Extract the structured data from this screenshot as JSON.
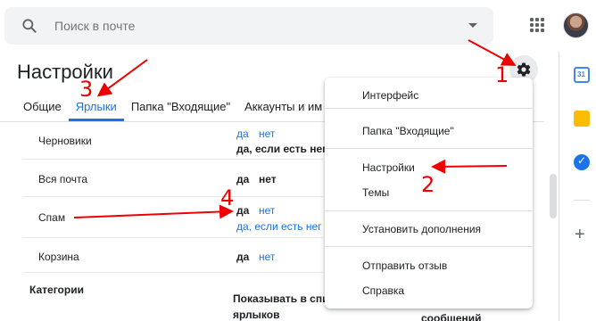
{
  "search": {
    "placeholder": "Поиск в почте",
    "value": ""
  },
  "header": {
    "title": "Настройки"
  },
  "tabs": [
    {
      "label": "Общие"
    },
    {
      "label": "Ярлыки"
    },
    {
      "label": "Папка \"Входящие\""
    },
    {
      "label": "Аккаунты и им"
    }
  ],
  "rows": [
    {
      "label": "Черновики",
      "links": [
        "да",
        "нет"
      ],
      "extra": "да, если есть нег"
    },
    {
      "label": "Вся почта",
      "bold": "да",
      "link": "нет"
    },
    {
      "label": "Спам",
      "bold": "да",
      "link": "нет",
      "extra": "да, если есть нег"
    },
    {
      "label": "Корзина",
      "bold": "да",
      "link": "нет"
    }
  ],
  "categories": {
    "label": "Категории",
    "text_line1": "Показывать в спи",
    "text_line2": "ярлыков",
    "extra": "сообщений"
  },
  "menu": {
    "items": [
      "Интерфейс",
      "Папка \"Входящие\"",
      "Настройки",
      "Темы",
      "Установить дополнения",
      "Отправить отзыв",
      "Справка"
    ]
  },
  "annotations": [
    "1",
    "2",
    "3",
    "4"
  ],
  "colors": {
    "accent": "#1a73e8",
    "annotation": "#ee0000"
  },
  "icons": {
    "search": "search-icon",
    "gear": "gear-icon",
    "apps": "apps-grid-icon"
  }
}
